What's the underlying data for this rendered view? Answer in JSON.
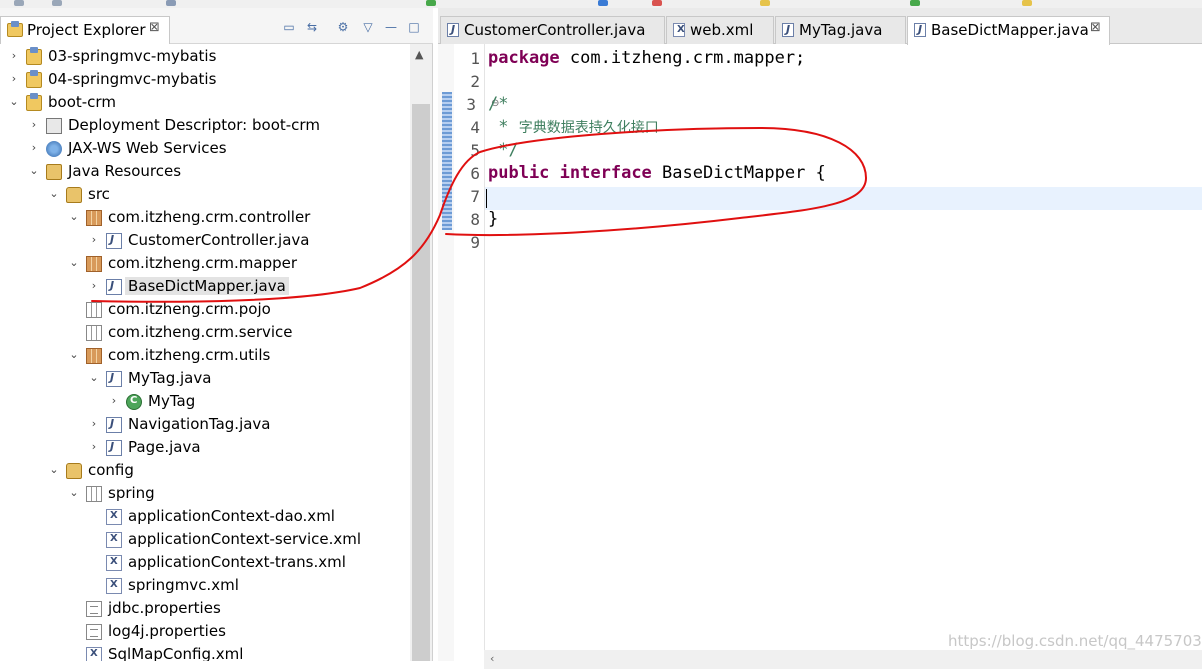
{
  "explorer": {
    "tab_label": "Project Explorer",
    "tab_close": "⊠",
    "tools": [
      "▭",
      "⇆",
      "⚙",
      "▽",
      "—",
      "□"
    ]
  },
  "tree": [
    {
      "label": "03-springmvc-mybatis",
      "icon": "project-icon",
      "toggle": "›"
    },
    {
      "label": "04-springmvc-mybatis",
      "icon": "project-icon",
      "toggle": "›"
    },
    {
      "label": "boot-crm",
      "icon": "project-icon",
      "toggle": "⌄"
    },
    {
      "label": "Deployment Descriptor: boot-crm",
      "icon": "deployment-descriptor-icon",
      "toggle": "›"
    },
    {
      "label": "JAX-WS Web Services",
      "icon": "web-services-icon",
      "toggle": "›"
    },
    {
      "label": "Java Resources",
      "icon": "java-resources-icon",
      "toggle": "⌄"
    },
    {
      "label": "src",
      "icon": "source-folder-icon",
      "toggle": "⌄"
    },
    {
      "label": "com.itzheng.crm.controller",
      "icon": "package-icon",
      "toggle": "⌄"
    },
    {
      "label": "CustomerController.java",
      "icon": "java-file-icon",
      "toggle": "›"
    },
    {
      "label": "com.itzheng.crm.mapper",
      "icon": "package-icon",
      "toggle": "⌄"
    },
    {
      "label": "BaseDictMapper.java",
      "icon": "java-interface-icon",
      "toggle": "›",
      "selected": true
    },
    {
      "label": "com.itzheng.crm.pojo",
      "icon": "empty-package-icon",
      "toggle": ""
    },
    {
      "label": "com.itzheng.crm.service",
      "icon": "empty-package-icon",
      "toggle": ""
    },
    {
      "label": "com.itzheng.crm.utils",
      "icon": "package-icon",
      "toggle": "⌄"
    },
    {
      "label": "MyTag.java",
      "icon": "java-file-icon",
      "toggle": "⌄"
    },
    {
      "label": "MyTag",
      "icon": "class-icon",
      "toggle": "›"
    },
    {
      "label": "NavigationTag.java",
      "icon": "java-file-icon",
      "toggle": "›"
    },
    {
      "label": "Page.java",
      "icon": "java-file-icon",
      "toggle": "›"
    },
    {
      "label": "config",
      "icon": "source-folder-icon",
      "toggle": "⌄"
    },
    {
      "label": "spring",
      "icon": "empty-package-icon",
      "toggle": "⌄"
    },
    {
      "label": "applicationContext-dao.xml",
      "icon": "xml-file-icon",
      "toggle": ""
    },
    {
      "label": "applicationContext-service.xml",
      "icon": "xml-file-icon",
      "toggle": ""
    },
    {
      "label": "applicationContext-trans.xml",
      "icon": "xml-file-icon",
      "toggle": ""
    },
    {
      "label": "springmvc.xml",
      "icon": "xml-file-icon",
      "toggle": ""
    },
    {
      "label": "jdbc.properties",
      "icon": "properties-file-icon",
      "toggle": ""
    },
    {
      "label": "log4j.properties",
      "icon": "properties-file-icon",
      "toggle": ""
    },
    {
      "label": "SqlMapConfig.xml",
      "icon": "xml-file-icon",
      "toggle": ""
    }
  ],
  "editor_tabs": [
    {
      "label": "CustomerController.java",
      "icon": "java-file-icon"
    },
    {
      "label": "web.xml",
      "icon": "xml-file-icon"
    },
    {
      "label": "MyTag.java",
      "icon": "java-file-icon"
    },
    {
      "label": "BaseDictMapper.java",
      "icon": "java-file-icon",
      "active": true,
      "close": "⊠"
    }
  ],
  "code": {
    "line_numbers": [
      "1",
      "2",
      "3",
      "4",
      "5",
      "6",
      "7",
      "8",
      "9"
    ],
    "line1_kw": "package",
    "line1_rest": " com.itzheng.crm.mapper;",
    "line3": "/*",
    "line4_star": " * ",
    "line4_text": "字典数据表持久化接口",
    "line5": " */",
    "line6_kw1": "public",
    "line6_kw2": "interface",
    "line6_rest": " BaseDictMapper {",
    "line8": "}"
  },
  "watermark": "https://blog.csdn.net/qq_44757034",
  "colors": {
    "keyword": "#7f0055",
    "comment": "#3f7f5f",
    "annotation_red": "#e01010",
    "current_line": "#e8f2fe"
  }
}
